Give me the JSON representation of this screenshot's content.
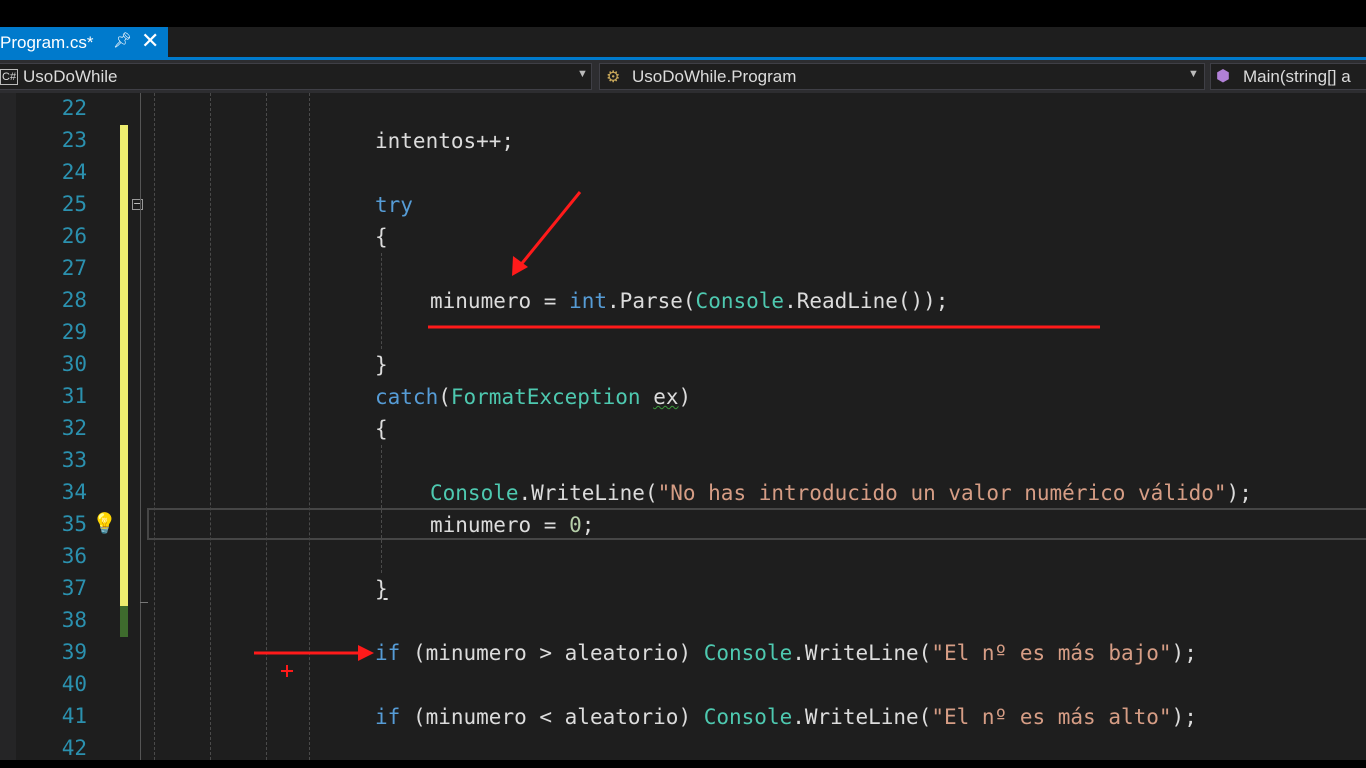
{
  "tab": {
    "title": "Program.cs*",
    "pin_icon": "pin-icon",
    "close_icon": "close-icon"
  },
  "navbar": {
    "project": {
      "badge": "C#",
      "label": "UsoDoWhile"
    },
    "class": {
      "label": "UsoDoWhile.Program"
    },
    "member": {
      "label": "Main(string[] a"
    }
  },
  "line_numbers": [
    "22",
    "23",
    "24",
    "25",
    "26",
    "27",
    "28",
    "29",
    "30",
    "31",
    "32",
    "33",
    "34",
    "35",
    "36",
    "37",
    "38",
    "39",
    "40",
    "41",
    "42"
  ],
  "code": {
    "l23": "intentos++;",
    "l25": "try",
    "l26": "{",
    "l28": {
      "var": "minumero",
      "eq": " = ",
      "int": "int",
      "dot_parse": ".Parse(",
      "console": "Console",
      "rest": ".ReadLine());"
    },
    "l30": "}",
    "l31": {
      "catch": "catch",
      "paren": "(",
      "type": "FormatException",
      "sp": " ",
      "ex": "ex",
      "close": ")"
    },
    "l32": "{",
    "l34": {
      "console": "Console",
      "method": ".WriteLine(",
      "str": "\"No has introducido un valor numérico válido\"",
      "end": ");"
    },
    "l35": {
      "text": "minumero = ",
      "num": "0",
      "end": ";"
    },
    "l37": "}",
    "l39": {
      "if": "if",
      "cond": " (minumero > aleatorio) ",
      "console": "Console",
      "method": ".WriteLine(",
      "str": "\"El nº es más bajo\"",
      "end": ");"
    },
    "l41": {
      "if": "if",
      "cond": " (minumero < aleatorio) ",
      "console": "Console",
      "method": ".WriteLine(",
      "str": "\"El nº es más alto\"",
      "end": ");"
    }
  },
  "colors": {
    "accent": "#007acc",
    "annotation": "#ff1a1a",
    "keyword": "#569cd6",
    "type": "#4ec9b0",
    "string": "#d69d85",
    "line_number": "#2b91af",
    "change_unsaved": "#eded6f",
    "change_saved": "#3e6b2d"
  },
  "icons": [
    "pin-icon",
    "close-icon",
    "csharp-project-icon",
    "class-icon",
    "method-icon",
    "lightbulb-icon",
    "collapse-icon"
  ]
}
